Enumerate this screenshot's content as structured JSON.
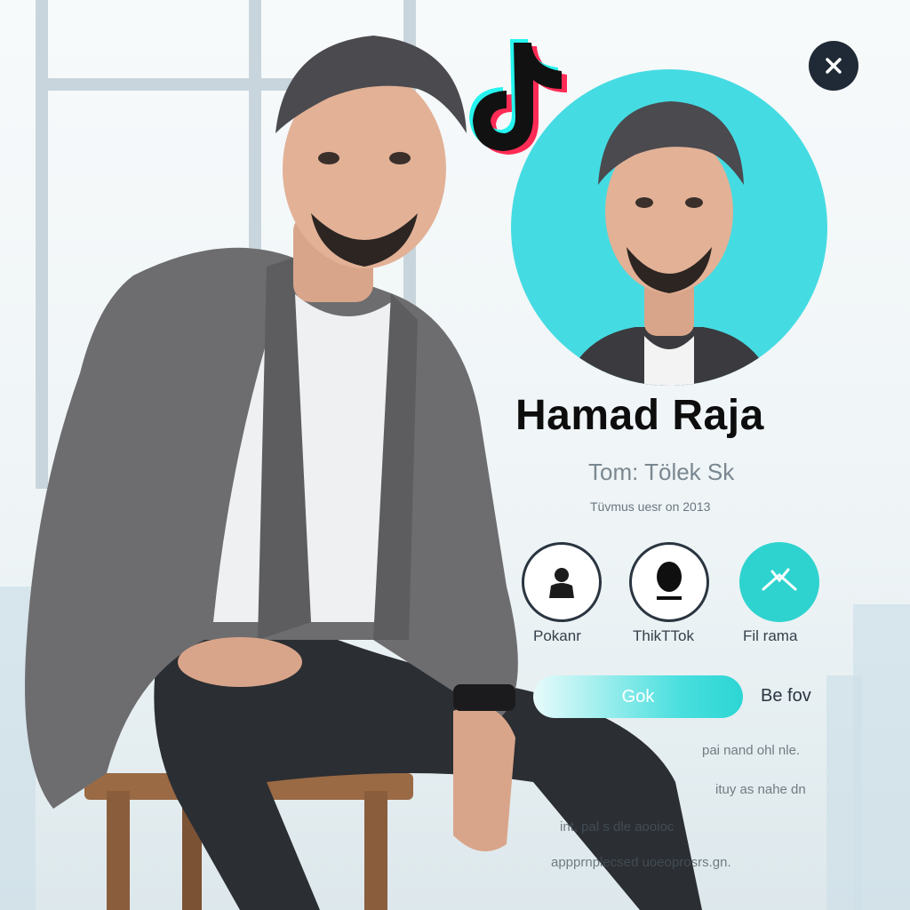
{
  "profile": {
    "name": "Hamad Raja",
    "handle": "Tom: Tölek Sk",
    "meta": "Tüvmus uesr on 2013"
  },
  "actions": [
    {
      "label": "Pokanr",
      "icon": "person-icon"
    },
    {
      "label": "ThikTTok",
      "icon": "silhouette-icon"
    },
    {
      "label": "Fil rama",
      "icon": "x-icon"
    }
  ],
  "follow_button": {
    "label": "Gok"
  },
  "side_link": {
    "label": "Be fov"
  },
  "bio_lines": [
    "pai nand ohl nle.",
    "ituy as nahe dn",
    "int, pal   s dle aooioc",
    "appprnplecsed   uoeoprosrs.gn."
  ],
  "colors": {
    "accent": "#45dbe2",
    "teal_button": "#2ed3cf",
    "close_bg": "#1f2a36"
  },
  "icons": {
    "close": "close-icon",
    "logo": "tiktok-logo"
  }
}
